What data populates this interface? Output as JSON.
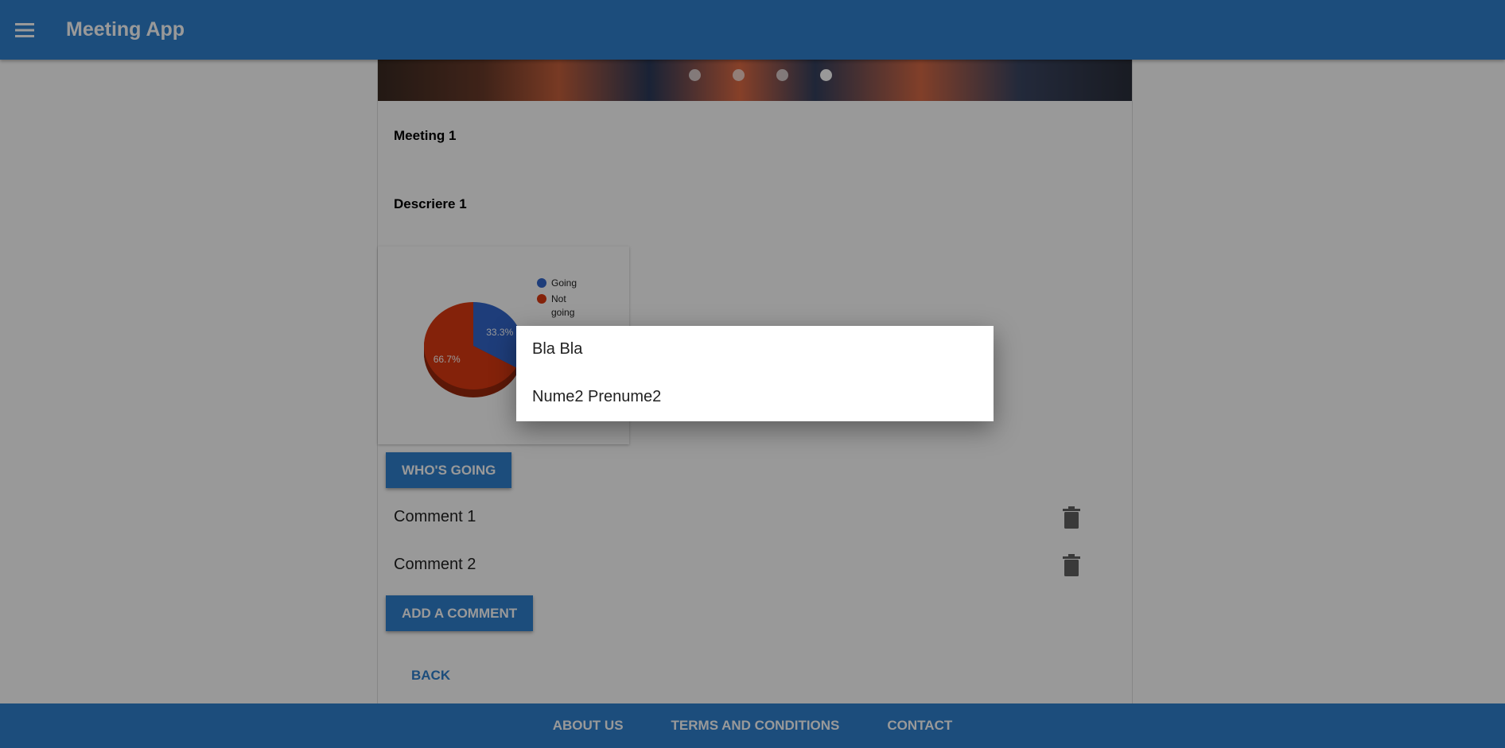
{
  "app": {
    "title": "Meeting App"
  },
  "carousel": {
    "slides": 4,
    "active_index": 3
  },
  "meeting": {
    "title": "Meeting 1",
    "description": "Descriere 1"
  },
  "chart_data": {
    "type": "pie",
    "categories": [
      "Going",
      "Not going"
    ],
    "values": [
      33.3,
      66.7
    ],
    "data_labels": [
      "33.3%",
      "66.7%"
    ],
    "colors": [
      "#3366cc",
      "#dc3912"
    ],
    "legend_position": "right",
    "three_d": true
  },
  "buttons": {
    "whos_going": "Who's going",
    "add_comment": "Add a comment",
    "back": "Back"
  },
  "comments": [
    {
      "text": "Comment 1"
    },
    {
      "text": "Comment 2"
    }
  ],
  "dialog": {
    "items": [
      {
        "label": "Bla Bla"
      },
      {
        "label": "Nume2 Prenume2"
      }
    ]
  },
  "footer": {
    "links": [
      {
        "label": "About us"
      },
      {
        "label": "Terms and conditions"
      },
      {
        "label": "Contact"
      }
    ]
  },
  "icons": {
    "menu": "hamburger-menu-icon",
    "delete": "trash-icon"
  },
  "colors": {
    "primary": "#2f80cf",
    "going": "#3366cc",
    "not_going": "#dc3912"
  }
}
